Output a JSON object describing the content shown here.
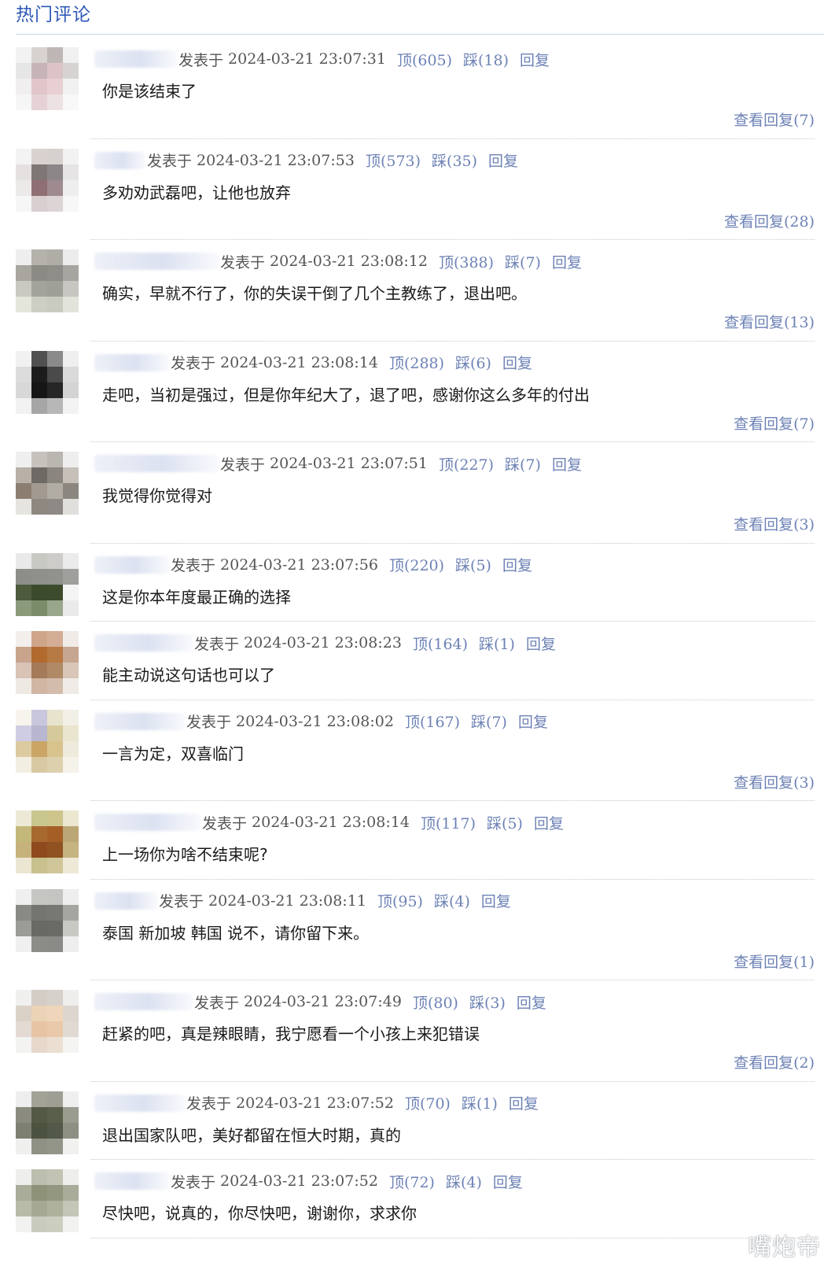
{
  "header": {
    "title": "热门评论"
  },
  "labels": {
    "posted": "发表于",
    "reply": "回复"
  },
  "comments": [
    {
      "user_w": 105,
      "time": "2024-03-21  23:07:31",
      "up": "顶(605)",
      "down": "踩(18)",
      "text": "你是该结束了",
      "view_replies": "查看回复(7)",
      "avatar": [
        "#f2f2f2",
        "#d8d3cf",
        "#bfb7b6",
        "#f0f0f0",
        "#e6e6e6",
        "#c7b4b8",
        "#dcc4c6",
        "#d8d3d3",
        "#f0eeee",
        "#e1c5c8",
        "#e8cfd1",
        "#f1f1f1",
        "#f6f6f6",
        "#e6d2d6",
        "#ede2e3",
        "#f8f8f8"
      ]
    },
    {
      "user_w": 65,
      "time": "2024-03-21  23:07:53",
      "up": "顶(573)",
      "down": "踩(35)",
      "text": "多劝劝武磊吧，让他也放弃",
      "view_replies": "查看回复(28)",
      "avatar": [
        "#f3f3f3",
        "#d9d2d0",
        "#d6d0ce",
        "#f2f2f2",
        "#e4e1e0",
        "#7f7676",
        "#8d8688",
        "#e6e4e4",
        "#ece9e9",
        "#8f6f74",
        "#9f8b8f",
        "#eeeeee",
        "#f6f6f6",
        "#d9cfd0",
        "#ddd4d5",
        "#f7f7f7"
      ]
    },
    {
      "user_w": 158,
      "time": "2024-03-21  23:08:12",
      "up": "顶(388)",
      "down": "踩(7)",
      "text": "确实，早就不行了，你的失误干倒了几个主教练了，退出吧。",
      "view_replies": "查看回复(13)",
      "avatar": [
        "#eeeeee",
        "#b5b1ab",
        "#b0ada7",
        "#ececec",
        "#a8a69f",
        "#8c8a84",
        "#8f8d87",
        "#a7a5a0",
        "#c9c8c1",
        "#a2a39b",
        "#9fa198",
        "#c7c6c0",
        "#e4e6dc",
        "#cdcfc5",
        "#c9cbc1",
        "#e2e3da"
      ]
    },
    {
      "user_w": 95,
      "time": "2024-03-21  23:08:14",
      "up": "顶(288)",
      "down": "踩(6)",
      "text": "走吧，当初是强过，但是你年纪大了，退了吧，感谢你这么多年的付出",
      "view_replies": "查看回复(7)",
      "avatar": [
        "#f1f1f1",
        "#505050",
        "#8a8a8a",
        "#efefef",
        "#dcdcdc",
        "#1c1c1c",
        "#4a4a4a",
        "#dadada",
        "#d8d8d8",
        "#161616",
        "#262626",
        "#d4d4d4",
        "#f2f2f2",
        "#a6a6a6",
        "#b7b7b7",
        "#f3f3f3"
      ]
    },
    {
      "user_w": 158,
      "time": "2024-03-21  23:07:51",
      "up": "顶(227)",
      "down": "踩(7)",
      "text": "我觉得你觉得对",
      "view_replies": "查看回复(3)",
      "avatar": [
        "#efefef",
        "#c7c2bd",
        "#bab6b0",
        "#eeeeee",
        "#b9b0a7",
        "#6e6964",
        "#8a857e",
        "#c6c0b9",
        "#8c7f72",
        "#a29a90",
        "#b1aca4",
        "#8b8780",
        "#e6e4e1",
        "#8f8881",
        "#8d8985",
        "#e1dfdc"
      ]
    },
    {
      "user_w": 95,
      "time": "2024-03-21  23:07:56",
      "up": "顶(220)",
      "down": "踩(5)",
      "text": "这是你本年度最正确的选择",
      "view_replies": null,
      "avatar": [
        "#e9e9e9",
        "#c9c9c4",
        "#cdccc8",
        "#ebebeb",
        "#8e8e88",
        "#8f8f8b",
        "#91918e",
        "#9f9f9b",
        "#4d5a3c",
        "#3b4a2b",
        "#3d4b2d",
        "#f4f4f4",
        "#8a9a7a",
        "#7a8c6a",
        "#98a68b",
        "#eaeaea"
      ]
    },
    {
      "user_w": 125,
      "time": "2024-03-21  23:08:23",
      "up": "顶(164)",
      "down": "踩(1)",
      "text": "能主动说这句话也可以了",
      "view_replies": null,
      "avatar": [
        "#f3efec",
        "#cfa58a",
        "#d3ad95",
        "#f1ebe7",
        "#c9a48d",
        "#b26a2f",
        "#b87a45",
        "#c7a691",
        "#d8c3b5",
        "#a47a58",
        "#b08966",
        "#d9c6b8",
        "#efe9e4",
        "#d0b6a3",
        "#d3bcac",
        "#f0ebe7"
      ]
    },
    {
      "user_w": 115,
      "time": "2024-03-21  23:08:02",
      "up": "顶(167)",
      "down": "踩(7)",
      "text": "一言为定，双喜临门",
      "view_replies": "查看回复(3)",
      "avatar": [
        "#f6f4ec",
        "#c9c7de",
        "#e7e3cd",
        "#f2f0e6",
        "#cfcde3",
        "#b9b6cf",
        "#d6c99c",
        "#e9e5cf",
        "#dccaa1",
        "#caa565",
        "#d9c38d",
        "#eeebdc",
        "#f2eee2",
        "#d8c9a3",
        "#ddd0ad",
        "#f5f2e9"
      ]
    },
    {
      "user_w": 135,
      "time": "2024-03-21  23:08:14",
      "up": "顶(117)",
      "down": "踩(5)",
      "text": "上一场你为啥不结束呢?",
      "view_replies": null,
      "avatar": [
        "#ece9d6",
        "#c9c68f",
        "#cdc58b",
        "#ebe7d1",
        "#c3b87a",
        "#a8692f",
        "#a65e27",
        "#bba675",
        "#c7b27b",
        "#8e4a1c",
        "#8f5220",
        "#c6b480",
        "#ebe6d1",
        "#c8c08d",
        "#d0c69a",
        "#eee9d7"
      ]
    },
    {
      "user_w": 80,
      "time": "2024-03-21  23:08:11",
      "up": "顶(95)",
      "down": "踩(4)",
      "text": "泰国 新加坡 韩国 说不，请你留下来。",
      "view_replies": "查看回复(1)",
      "avatar": [
        "#efefef",
        "#c6c6c2",
        "#c4c4c0",
        "#eeeeee",
        "#8a8a85",
        "#757570",
        "#777773",
        "#a6a6a0",
        "#9c9c96",
        "#6a6a65",
        "#6b6b66",
        "#c9c9c4",
        "#f0f0f0",
        "#8c8c88",
        "#8a8a86",
        "#eeeeee"
      ]
    },
    {
      "user_w": 125,
      "time": "2024-03-21  23:07:49",
      "up": "顶(80)",
      "down": "踩(3)",
      "text": "赶紧的吧，真是辣眼睛，我宁愿看一个小孩上来犯错误",
      "view_replies": "查看回复(2)",
      "avatar": [
        "#f0f0ef",
        "#d4cdc6",
        "#d6d1ca",
        "#eeeeec",
        "#dad2c7",
        "#ecd2b6",
        "#efd6ba",
        "#dcd6cf",
        "#e3dbd3",
        "#e6c4a4",
        "#e9c9a9",
        "#e0dad3",
        "#f3f3f2",
        "#e7d8cb",
        "#ebdfd2",
        "#f4f4f3"
      ]
    },
    {
      "user_w": 115,
      "time": "2024-03-21  23:07:52",
      "up": "顶(70)",
      "down": "踩(1)",
      "text": "退出国家队吧，美好都留在恒大时期，真的",
      "view_replies": null,
      "avatar": [
        "#eeeeee",
        "#a2a297",
        "#9e9e94",
        "#efefef",
        "#8b8c7f",
        "#545946",
        "#5a5f4b",
        "#9b9c90",
        "#7d7f71",
        "#4c5240",
        "#53594a",
        "#8d8f82",
        "#f0f0ef",
        "#8f9185",
        "#939589",
        "#f1f1f0"
      ]
    },
    {
      "user_w": 95,
      "time": "2024-03-21  23:07:52",
      "up": "顶(72)",
      "down": "踩(4)",
      "text": "尽快吧，说真的，你尽快吧，谢谢你，求求你",
      "view_replies": null,
      "avatar": [
        "#eeeeec",
        "#bdbfae",
        "#c2c3b3",
        "#eeeeec",
        "#a8ac98",
        "#8e9279",
        "#939780",
        "#a9ac99",
        "#b8bba9",
        "#a5a994",
        "#aeb19c",
        "#c4c6b7",
        "#f2f2f0",
        "#c9cbbe",
        "#cccebf",
        "#f2f2f0"
      ]
    }
  ],
  "watermark": "嘴炮帝",
  "colors": {
    "link": "#6d82b5",
    "header": "#2e58b8",
    "divider": "#c8c8c8"
  }
}
